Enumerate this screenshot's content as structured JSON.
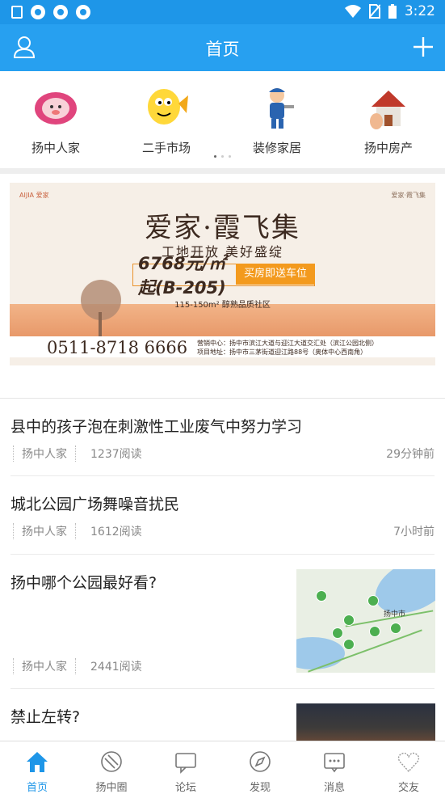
{
  "status_bar": {
    "time": "3:22"
  },
  "header": {
    "title": "首页"
  },
  "categories": [
    {
      "label": "扬中人家",
      "icon": "pig-mascot-icon"
    },
    {
      "label": "二手市场",
      "icon": "fish-mascot-icon"
    },
    {
      "label": "装修家居",
      "icon": "worker-mascot-icon"
    },
    {
      "label": "扬中房产",
      "icon": "house-icon"
    }
  ],
  "banner": {
    "brand": "AIJIA 爱家",
    "brand_right": "爱家·霞飞集",
    "title": "爱家·霞飞集",
    "subtitle": "工地开放 美好盛绽",
    "price": "6768元/㎡起(B-205)",
    "price_tag": "买房即送车位",
    "area": "115-150m² 醇熟品质社区",
    "phone": "0511-8718 6666",
    "address_line1": "营销中心：扬中市滨江大道与迎江大道交汇处（滨江公园北侧）",
    "address_line2": "项目地址：扬中市三茅街道迎江路88号（奥体中心西南角）"
  },
  "feed": [
    {
      "title": "县中的孩子泡在刺激性工业废气中努力学习",
      "source": "扬中人家",
      "reads": "1237阅读",
      "time": "29分钟前"
    },
    {
      "title": "城北公园广场舞噪音扰民",
      "source": "扬中人家",
      "reads": "1612阅读",
      "time": "7小时前"
    },
    {
      "title": "扬中哪个公园最好看?",
      "source": "扬中人家",
      "reads": "2441阅读",
      "time": "",
      "map_label": "扬中市"
    },
    {
      "title": "禁止左转?",
      "source": "",
      "reads": "",
      "time": ""
    }
  ],
  "tabs": [
    {
      "label": "首页",
      "icon": "home-icon"
    },
    {
      "label": "扬中圈",
      "icon": "circle-icon"
    },
    {
      "label": "论坛",
      "icon": "forum-icon"
    },
    {
      "label": "发现",
      "icon": "compass-icon"
    },
    {
      "label": "消息",
      "icon": "message-icon"
    },
    {
      "label": "交友",
      "icon": "heart-icon"
    }
  ],
  "colors": {
    "primary": "#27a0f0",
    "status_bar": "#1e96e8",
    "accent_orange": "#f39a1e"
  }
}
